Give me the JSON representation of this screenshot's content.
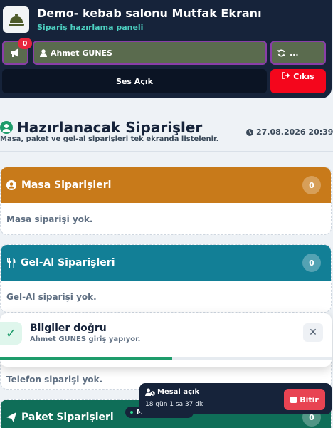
{
  "header": {
    "title": "Demo- kebab salonu Mutfak Ekranı",
    "subtitle": "Sipariş hazırlama paneli",
    "notification_count": "0",
    "user_name": "Ahmet GUNES",
    "sync_label": "...",
    "sound_label": "Ses Açık",
    "logout_label": "Çıkış"
  },
  "page": {
    "title": "Hazırlanacak Siparişler",
    "description": "Masa, paket ve gel-al siparişleri tek ekranda listelenir.",
    "datetime": "27.08.2026 20:39"
  },
  "sections": [
    {
      "title": "Masa Siparişleri",
      "count": "0",
      "empty_text": "Masa siparişi yok.",
      "color": "#c87a1a"
    },
    {
      "title": "Gel-Al Siparişleri",
      "count": "0",
      "empty_text": "Gel-Al siparişi yok.",
      "color": "#127f96"
    },
    {
      "title": "",
      "count": "",
      "empty_text": "Telefon siparişi yok.",
      "color": "#b51d2c"
    },
    {
      "title": "Paket Siparişleri",
      "count": "0",
      "empty_text": "",
      "color": "#0f6e58"
    }
  ],
  "toast": {
    "title": "Bilgiler doğru",
    "message": "Ahmet GUNES giriş yapıyor.",
    "close_icon": "close-icon",
    "progress": 0.52
  },
  "shift": {
    "title": "Mesai açık",
    "duration": "18 gün 1 sa 37 dk",
    "finish_label": "Bitir"
  },
  "mini_status": {
    "text": "M"
  },
  "icons": {
    "logo": "bell-icon",
    "notification": "megaphone-icon",
    "user": "user-icon",
    "sync": "sync-icon",
    "logout": "sign-out-icon",
    "title": "user-circle-icon",
    "clock": "clock-icon"
  },
  "colors": {
    "accent_green": "#4dd0c1",
    "nav_dark": "#16233a",
    "danger": "#f4061c"
  }
}
